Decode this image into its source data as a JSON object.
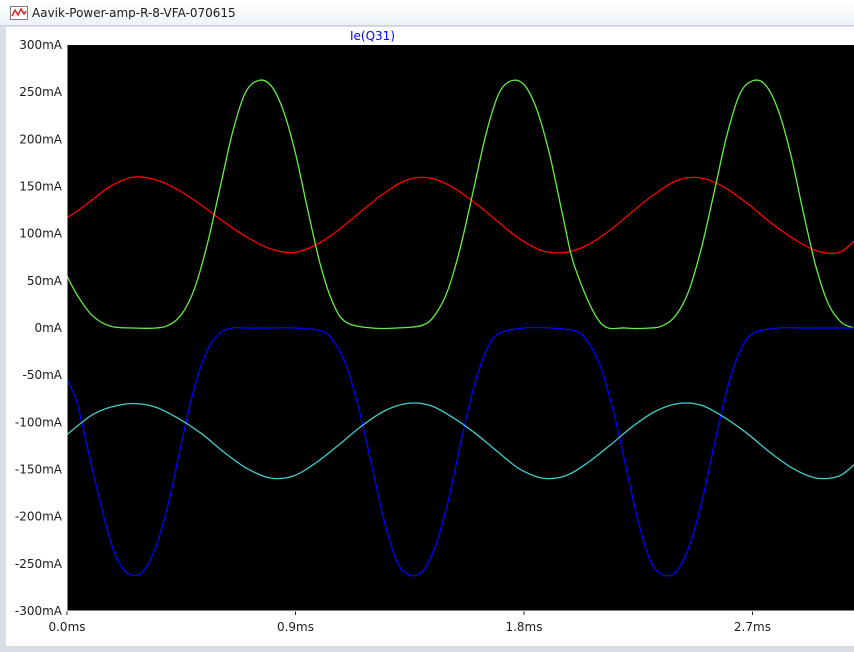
{
  "window": {
    "title": "Aavik-Power-amp-R-8-VFA-070615"
  },
  "colors": {
    "background": "#000000",
    "axis": "#ffffff",
    "trace_label": "#0000ff"
  },
  "chart_data": {
    "type": "line",
    "title": "",
    "xlabel": "",
    "ylabel": "",
    "xlim": [
      0,
      3.1
    ],
    "ylim": [
      -300,
      300
    ],
    "x_unit": "ms",
    "y_unit": "mA",
    "grid": false,
    "legend": "top-left",
    "xticks": [
      0,
      0.9,
      1.8,
      2.7
    ],
    "xtick_labels": [
      "0.0ms",
      "0.9ms",
      "1.8ms",
      "2.7ms"
    ],
    "yticks": [
      300,
      250,
      200,
      150,
      100,
      50,
      0,
      -50,
      -100,
      -150,
      -200,
      -250,
      -300
    ],
    "ytick_labels": [
      "300mA",
      "250mA",
      "200mA",
      "150mA",
      "100mA",
      "50mA",
      "0mA",
      "-50mA",
      "-100mA",
      "-150mA",
      "-200mA",
      "-250mA",
      "-300mA"
    ],
    "trace_label": "Ie(Q31)",
    "series": [
      {
        "color": "#ff0000",
        "x": [
          0,
          0.04,
          0.1,
          0.17,
          0.26,
          0.35,
          0.44,
          0.53,
          0.62,
          0.71,
          0.8,
          0.89,
          0.98,
          1.07,
          1.16,
          1.25,
          1.34,
          1.43,
          1.52,
          1.61,
          1.7,
          1.78,
          1.87,
          1.96,
          2.05,
          2.14,
          2.23,
          2.32,
          2.41,
          2.5,
          2.59,
          2.68,
          2.77,
          2.86,
          2.95,
          3.04,
          3.1
        ],
        "y": [
          117,
          124,
          136,
          150,
          160,
          157,
          146,
          130,
          112,
          96,
          84,
          80,
          88,
          104,
          124,
          143,
          157,
          159,
          149,
          132,
          112,
          95,
          82,
          80,
          88,
          104,
          124,
          143,
          157,
          159,
          149,
          132,
          112,
          95,
          82,
          80,
          92
        ]
      },
      {
        "color": "#66ee44",
        "x": [
          0,
          0.04,
          0.1,
          0.17,
          0.26,
          0.35,
          0.4,
          0.45,
          0.5,
          0.55,
          0.6,
          0.65,
          0.7,
          0.75,
          0.8,
          0.85,
          0.9,
          0.95,
          1.0,
          1.05,
          1.1,
          1.2,
          1.3,
          1.4,
          1.45,
          1.5,
          1.55,
          1.6,
          1.65,
          1.7,
          1.75,
          1.8,
          1.85,
          1.9,
          1.95,
          2.0,
          2.1,
          2.2,
          2.3,
          2.35,
          2.4,
          2.45,
          2.5,
          2.55,
          2.6,
          2.65,
          2.7,
          2.75,
          2.8,
          2.85,
          2.9,
          2.95,
          3.0,
          3.05,
          3.1
        ],
        "y": [
          55,
          35,
          13,
          2,
          0,
          0,
          3,
          14,
          40,
          86,
          145,
          205,
          248,
          262,
          258,
          232,
          185,
          123,
          65,
          25,
          6,
          0,
          0,
          3,
          14,
          40,
          86,
          145,
          205,
          248,
          262,
          258,
          232,
          185,
          123,
          65,
          6,
          0,
          0,
          3,
          14,
          40,
          86,
          145,
          205,
          248,
          262,
          258,
          232,
          185,
          123,
          65,
          25,
          6,
          0
        ]
      },
      {
        "color": "#0000ff",
        "x": [
          0,
          0.04,
          0.1,
          0.17,
          0.22,
          0.26,
          0.3,
          0.35,
          0.4,
          0.45,
          0.5,
          0.55,
          0.6,
          0.65,
          0.7,
          0.8,
          0.9,
          1.0,
          1.05,
          1.1,
          1.15,
          1.2,
          1.25,
          1.3,
          1.35,
          1.4,
          1.45,
          1.5,
          1.55,
          1.6,
          1.65,
          1.7,
          1.8,
          1.9,
          2.0,
          2.05,
          2.1,
          2.15,
          2.2,
          2.25,
          2.3,
          2.35,
          2.4,
          2.45,
          2.5,
          2.55,
          2.6,
          2.65,
          2.7,
          2.8,
          2.9,
          3.0,
          3.1
        ],
        "y": [
          -55,
          -80,
          -150,
          -225,
          -255,
          -262,
          -258,
          -232,
          -185,
          -123,
          -65,
          -25,
          -6,
          0,
          0,
          0,
          0,
          -3,
          -14,
          -40,
          -86,
          -145,
          -205,
          -248,
          -262,
          -258,
          -232,
          -185,
          -123,
          -65,
          -25,
          -6,
          0,
          0,
          -3,
          -14,
          -40,
          -86,
          -145,
          -205,
          -248,
          -262,
          -258,
          -232,
          -185,
          -123,
          -65,
          -25,
          -6,
          0,
          0,
          0,
          0
        ]
      },
      {
        "color": "#44cccc",
        "x": [
          0,
          0.04,
          0.1,
          0.17,
          0.26,
          0.35,
          0.44,
          0.53,
          0.62,
          0.71,
          0.8,
          0.89,
          0.98,
          1.07,
          1.16,
          1.25,
          1.34,
          1.43,
          1.52,
          1.61,
          1.7,
          1.78,
          1.87,
          1.96,
          2.05,
          2.14,
          2.23,
          2.32,
          2.41,
          2.5,
          2.59,
          2.68,
          2.77,
          2.86,
          2.95,
          3.04,
          3.1
        ],
        "y": [
          -113,
          -104,
          -92,
          -84,
          -80,
          -84,
          -96,
          -112,
          -132,
          -149,
          -159,
          -157,
          -143,
          -124,
          -104,
          -88,
          -80,
          -82,
          -95,
          -112,
          -132,
          -149,
          -159,
          -157,
          -143,
          -124,
          -104,
          -88,
          -80,
          -82,
          -95,
          -112,
          -132,
          -149,
          -159,
          -157,
          -145
        ]
      }
    ]
  }
}
